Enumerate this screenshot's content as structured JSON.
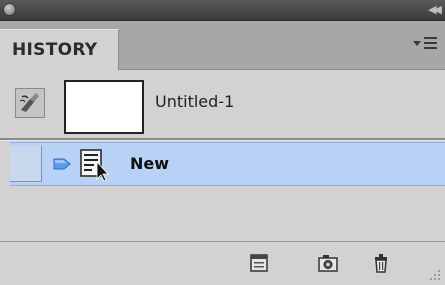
{
  "panel": {
    "tab_label": "HISTORY"
  },
  "snapshot": {
    "name": "Untitled-1"
  },
  "states": [
    {
      "name": "New",
      "selected": true
    }
  ],
  "colors": {
    "selected_row": "#b8d2f6",
    "panel_bg": "#d2d2d2",
    "title_bar": "#3a3a3a"
  },
  "icons": {
    "title": [
      "close-icon",
      "collapse-icon"
    ],
    "tab": [
      "panel-menu-icon"
    ],
    "toolbar": [
      "new-document-from-state-icon",
      "new-snapshot-icon",
      "delete-state-icon"
    ]
  }
}
